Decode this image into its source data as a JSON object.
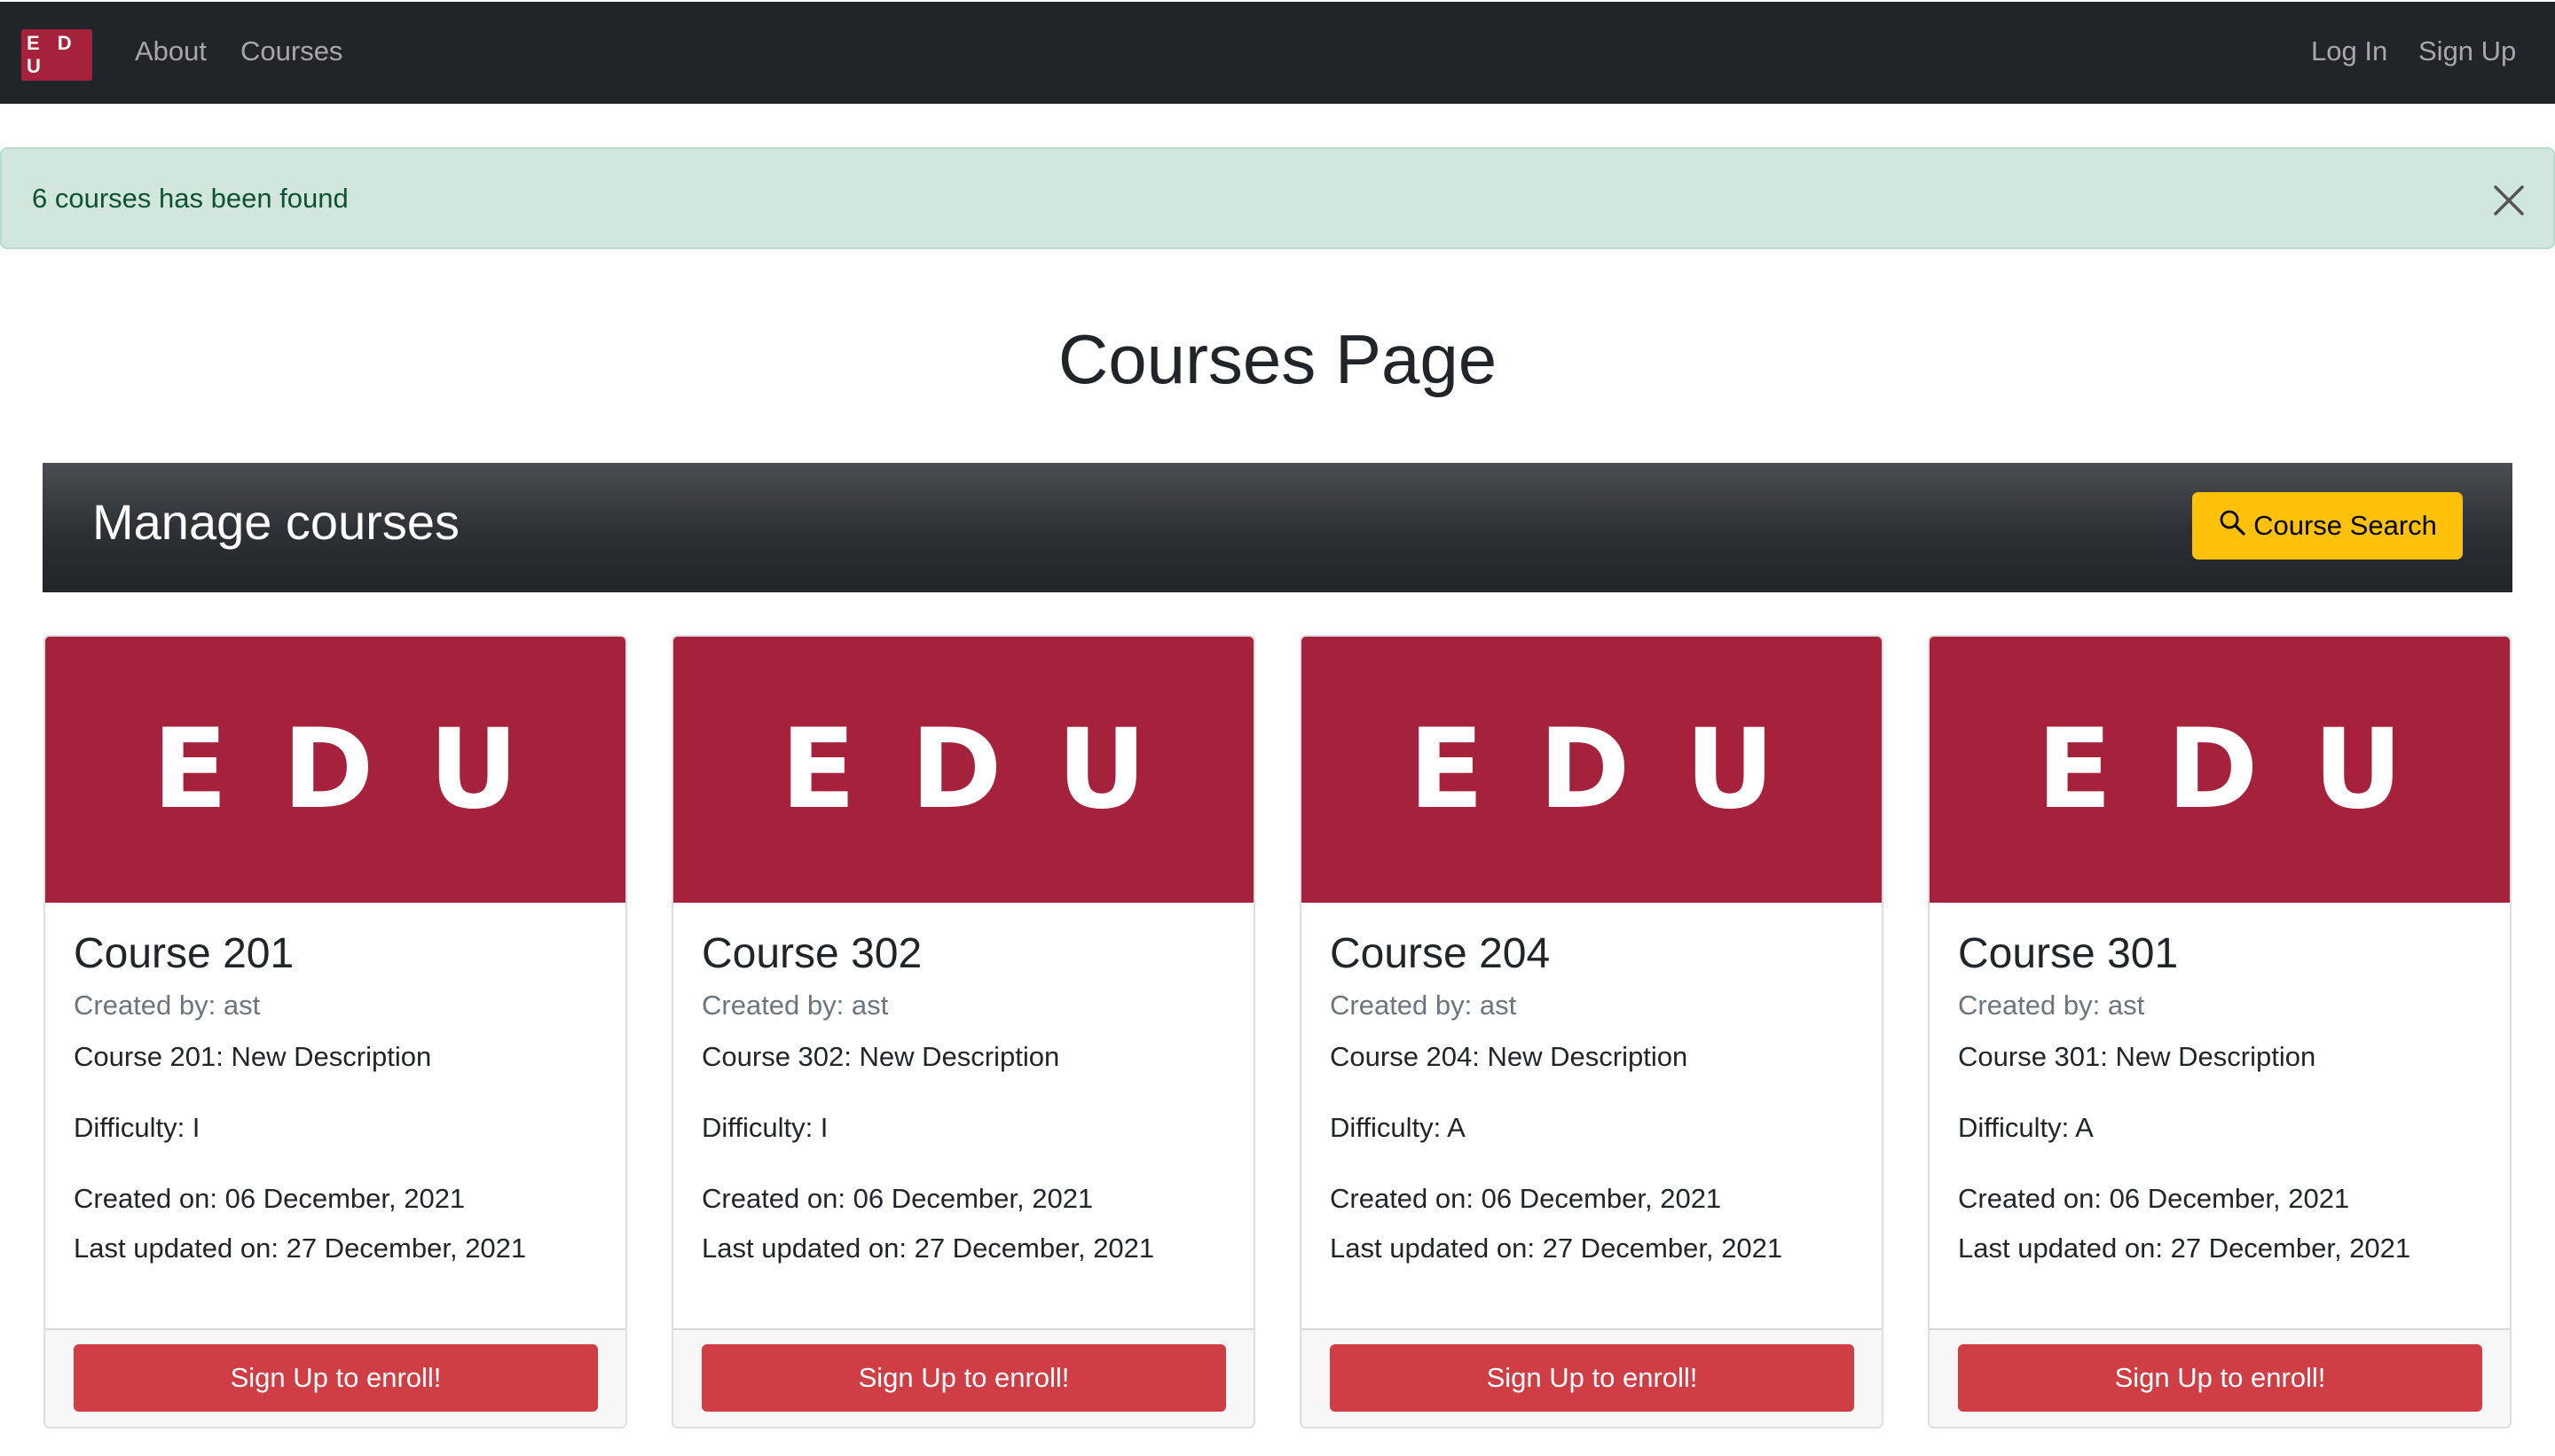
{
  "nav": {
    "brand": "E D U",
    "links": [
      "About",
      "Courses"
    ],
    "login": "Log In",
    "signup": "Sign Up"
  },
  "alert": {
    "message": "6 courses has been found",
    "close_icon": "close-icon"
  },
  "page": {
    "title": "Courses Page"
  },
  "manage": {
    "title": "Manage courses",
    "search_label": "Course Search",
    "search_icon": "search-icon"
  },
  "colors": {
    "brand": "#a6213b",
    "navbar": "#212529",
    "alert_bg": "#d1e7dd",
    "warning": "#ffc107",
    "danger": "#dc3545"
  },
  "cards": [
    {
      "image_text": "EDU",
      "title": "Course 201",
      "creator": "Created by: ast",
      "description": "Course 201: New Description",
      "difficulty": "Difficulty: I",
      "created_on": "Created on: 06 December, 2021",
      "updated_on": "Last updated on: 27 December, 2021",
      "button": "Sign Up to enroll!"
    },
    {
      "image_text": "EDU",
      "title": "Course 302",
      "creator": "Created by: ast",
      "description": "Course 302: New Description",
      "difficulty": "Difficulty: I",
      "created_on": "Created on: 06 December, 2021",
      "updated_on": "Last updated on: 27 December, 2021",
      "button": "Sign Up to enroll!"
    },
    {
      "image_text": "EDU",
      "title": "Course 204",
      "creator": "Created by: ast",
      "description": "Course 204: New Description",
      "difficulty": "Difficulty: A",
      "created_on": "Created on: 06 December, 2021",
      "updated_on": "Last updated on: 27 December, 2021",
      "button": "Sign Up to enroll!"
    },
    {
      "image_text": "EDU",
      "title": "Course 301",
      "creator": "Created by: ast",
      "description": "Course 301: New Description",
      "difficulty": "Difficulty: A",
      "created_on": "Created on: 06 December, 2021",
      "updated_on": "Last updated on: 27 December, 2021",
      "button": "Sign Up to enroll!"
    }
  ]
}
